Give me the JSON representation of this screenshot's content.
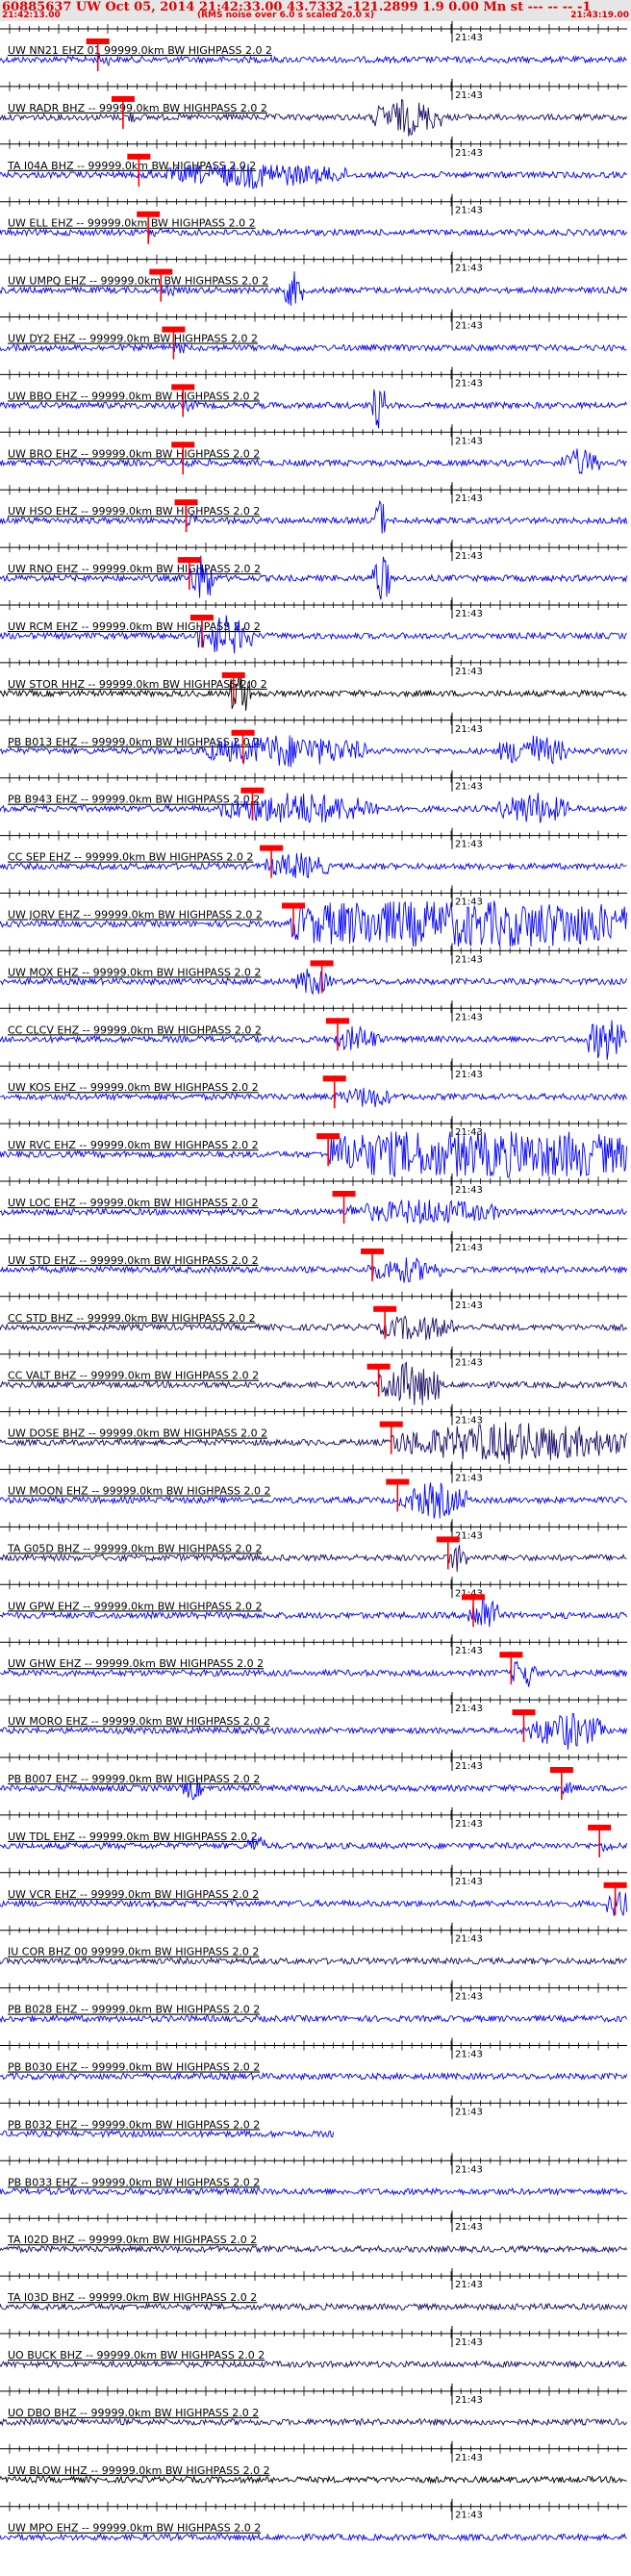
{
  "header": {
    "title": "60885637 UW Oct 05, 2014 21:42:33.00   43.7332 -121.2899  1.9 0.00 Mn st --- -- --  -1",
    "start_time": "21:42:13.00",
    "end_time": "21:43:19.00",
    "rms_note": "(RMS noise over 6.0 s scaled 20.0 x)"
  },
  "chart_data": {
    "type": "seismogram",
    "time_tick_label": "21:43",
    "colors": {
      "trace_blue": "#0000ff",
      "trace_navy": "#1a0a66",
      "trace_black": "#000000",
      "pick": "#ff0000",
      "axis": "#000000",
      "text": "#000000"
    },
    "stations": [
      {
        "label": "UW NN21 EHZ 01 99999.0km BW  HIGHPASS  2.0  2",
        "color": "blue",
        "pick": 0.155,
        "burst": null,
        "bursts2": null
      },
      {
        "label": "UW RADR BHZ -- 99999.0km BW  HIGHPASS  2.0  2",
        "color": "navy",
        "pick": 0.195,
        "burst": [
          0.59,
          0.7,
          2.0
        ],
        "bursts2": null
      },
      {
        "label": "TA I04A BHZ -- 99999.0km BW  HIGHPASS  2.0  2",
        "color": "blue",
        "pick": 0.22,
        "burst": [
          0.26,
          0.55,
          1.4
        ],
        "bursts2": null
      },
      {
        "label": "UW ELL EHZ -- 99999.0km BW  HIGHPASS  2.0  2",
        "color": "blue",
        "pick": 0.235,
        "burst": null,
        "bursts2": null
      },
      {
        "label": "UW UMPQ EHZ -- 99999.0km BW  HIGHPASS  2.0  2",
        "color": "blue",
        "pick": 0.255,
        "burst": [
          0.45,
          0.48,
          2.0
        ],
        "bursts2": null
      },
      {
        "label": "UW DY2 EHZ -- 99999.0km BW  HIGHPASS  2.0  2",
        "color": "blue",
        "pick": 0.275,
        "burst": null,
        "bursts2": null
      },
      {
        "label": "UW BBO EHZ -- 99999.0km BW  HIGHPASS  2.0  2",
        "color": "blue",
        "pick": 0.29,
        "burst": [
          0.59,
          0.61,
          3.0
        ],
        "bursts2": null
      },
      {
        "label": "UW BRO EHZ -- 99999.0km BW  HIGHPASS  2.0  2",
        "color": "blue",
        "pick": 0.29,
        "burst": [
          0.89,
          0.95,
          1.6
        ],
        "bursts2": null
      },
      {
        "label": "UW HSO EHZ -- 99999.0km BW  HIGHPASS  2.0  2",
        "color": "blue",
        "pick": 0.295,
        "burst": [
          0.59,
          0.61,
          3.0
        ],
        "bursts2": null
      },
      {
        "label": "UW RNO EHZ -- 99999.0km BW  HIGHPASS  2.0  2",
        "color": "blue",
        "pick": 0.3,
        "burst": [
          0.3,
          0.34,
          3.0
        ],
        "bursts2": [
          0.59,
          0.62,
          3.0
        ]
      },
      {
        "label": "UW RCM EHZ -- 99999.0km BW  HIGHPASS  2.0  2",
        "color": "blue",
        "pick": 0.32,
        "burst": [
          0.31,
          0.4,
          2.2
        ],
        "bursts2": null
      },
      {
        "label": "UW STOR HHZ -- 99999.0km BW  HIGHPASS  2.0  2",
        "color": "black",
        "pick": 0.37,
        "burst": [
          0.36,
          0.4,
          2.4
        ],
        "bursts2": null
      },
      {
        "label": "PB B013 EHZ -- 99999.0km BW  HIGHPASS  2.0  2",
        "color": "blue",
        "pick": 0.385,
        "burst": [
          0.32,
          0.58,
          1.8
        ],
        "bursts2": [
          0.79,
          0.9,
          1.8
        ]
      },
      {
        "label": "PB B943 EHZ -- 99999.0km BW  HIGHPASS  2.0  2",
        "color": "blue",
        "pick": 0.4,
        "burst": [
          0.35,
          0.6,
          1.8
        ],
        "bursts2": [
          0.79,
          0.9,
          1.8
        ]
      },
      {
        "label": "CC SEP EHZ -- 99999.0km BW  HIGHPASS  2.0  2",
        "color": "blue",
        "pick": 0.43,
        "burst": [
          0.42,
          0.52,
          1.5
        ],
        "bursts2": null
      },
      {
        "label": "UW JORV EHZ -- 99999.0km BW  HIGHPASS  2.0  2",
        "color": "blue",
        "pick": 0.465,
        "burst": [
          0.46,
          1.0,
          3.5
        ],
        "bursts2": null
      },
      {
        "label": "UW MOX EHZ -- 99999.0km BW  HIGHPASS  2.0  2",
        "color": "blue",
        "pick": 0.51,
        "burst": [
          0.47,
          0.52,
          1.6
        ],
        "bursts2": null
      },
      {
        "label": "CC CLCV EHZ -- 99999.0km BW  HIGHPASS  2.0  2",
        "color": "blue",
        "pick": 0.535,
        "burst": [
          0.53,
          0.6,
          1.5
        ],
        "bursts2": [
          0.93,
          0.99,
          2.5
        ]
      },
      {
        "label": "UW KOS EHZ -- 99999.0km BW  HIGHPASS  2.0  2",
        "color": "blue",
        "pick": 0.53,
        "burst": [
          0.55,
          0.62,
          1.3
        ],
        "bursts2": null
      },
      {
        "label": "UW RVC EHZ -- 99999.0km BW  HIGHPASS  2.0  2",
        "color": "blue",
        "pick": 0.52,
        "burst": [
          0.52,
          1.0,
          3.5
        ],
        "bursts2": null
      },
      {
        "label": "UW LOC EHZ -- 99999.0km BW  HIGHPASS  2.0  2",
        "color": "blue",
        "pick": 0.545,
        "burst": [
          0.55,
          0.8,
          1.4
        ],
        "bursts2": null
      },
      {
        "label": "UW STD EHZ -- 99999.0km BW  HIGHPASS  2.0  2",
        "color": "blue",
        "pick": 0.59,
        "burst": [
          0.58,
          0.7,
          1.4
        ],
        "bursts2": null
      },
      {
        "label": "CC STD BHZ -- 99999.0km BW  HIGHPASS  2.0  2",
        "color": "navy",
        "pick": 0.61,
        "burst": [
          0.6,
          0.72,
          1.5
        ],
        "bursts2": null
      },
      {
        "label": "CC VALT BHZ -- 99999.0km BW  HIGHPASS  2.0  2",
        "color": "navy",
        "pick": 0.6,
        "burst": [
          0.6,
          0.7,
          2.6
        ],
        "bursts2": null
      },
      {
        "label": "UW DOSE BHZ -- 99999.0km BW  HIGHPASS  2.0  2",
        "color": "navy",
        "pick": 0.62,
        "burst": [
          0.62,
          1.0,
          2.2
        ],
        "bursts2": null
      },
      {
        "label": "UW MOON EHZ -- 99999.0km BW  HIGHPASS  2.0  2",
        "color": "blue",
        "pick": 0.63,
        "burst": [
          0.64,
          0.74,
          2.0
        ],
        "bursts2": null
      },
      {
        "label": "TA G05D BHZ -- 99999.0km BW  HIGHPASS  2.0  2",
        "color": "navy",
        "pick": 0.71,
        "burst": [
          0.71,
          0.74,
          1.6
        ],
        "bursts2": null
      },
      {
        "label": "UW GPW EHZ -- 99999.0km BW  HIGHPASS  2.0  2",
        "color": "blue",
        "pick": 0.75,
        "burst": [
          0.74,
          0.79,
          2.4
        ],
        "bursts2": null
      },
      {
        "label": "UW GHW EHZ -- 99999.0km BW  HIGHPASS  2.0  2",
        "color": "blue",
        "pick": 0.81,
        "burst": [
          0.81,
          0.85,
          1.8
        ],
        "bursts2": null
      },
      {
        "label": "UW MORO EHZ -- 99999.0km BW  HIGHPASS  2.0  2",
        "color": "blue",
        "pick": 0.83,
        "burst": [
          0.84,
          0.96,
          2.0
        ],
        "bursts2": null
      },
      {
        "label": "PB B007 EHZ -- 99999.0km BW  HIGHPASS  2.0  2",
        "color": "blue",
        "pick": 0.89,
        "burst": [
          0.29,
          0.32,
          1.3
        ],
        "bursts2": null
      },
      {
        "label": "UW TDL EHZ -- 99999.0km BW  HIGHPASS  2.0  2",
        "color": "blue",
        "pick": 0.95,
        "burst": [
          0.39,
          0.42,
          1.3
        ],
        "bursts2": null
      },
      {
        "label": "UW VCR EHZ -- 99999.0km BW  HIGHPASS  2.0  2",
        "color": "blue",
        "pick": 0.975,
        "burst": [
          0.96,
          1.0,
          1.6
        ],
        "bursts2": null
      },
      {
        "label": "IU COR BHZ 00 99999.0km BW  HIGHPASS  2.0  2",
        "color": "navy",
        "pick": null,
        "burst": null,
        "bursts2": null
      },
      {
        "label": "PB B028 EHZ -- 99999.0km BW  HIGHPASS  2.0  2",
        "color": "blue",
        "pick": null,
        "burst": null,
        "bursts2": null
      },
      {
        "label": "PB B030 EHZ -- 99999.0km BW  HIGHPASS  2.0  2",
        "color": "blue",
        "pick": null,
        "burst": null,
        "bursts2": null
      },
      {
        "label": "PB B032 EHZ -- 99999.0km BW  HIGHPASS  2.0  2",
        "color": "blue",
        "pick": null,
        "burst": null,
        "bursts2": null,
        "truncate": 0.53
      },
      {
        "label": "PB B033 EHZ -- 99999.0km BW  HIGHPASS  2.0  2",
        "color": "blue",
        "pick": null,
        "burst": null,
        "bursts2": null
      },
      {
        "label": "TA I02D BHZ -- 99999.0km BW  HIGHPASS  2.0  2",
        "color": "navy",
        "pick": null,
        "burst": null,
        "bursts2": null
      },
      {
        "label": "TA I03D BHZ -- 99999.0km BW  HIGHPASS  2.0  2",
        "color": "navy",
        "pick": null,
        "burst": null,
        "bursts2": null
      },
      {
        "label": "UO BUCK BHZ -- 99999.0km BW  HIGHPASS  2.0  2",
        "color": "navy",
        "pick": null,
        "burst": null,
        "bursts2": null
      },
      {
        "label": "UO DBO BHZ -- 99999.0km BW  HIGHPASS  2.0  2",
        "color": "navy",
        "pick": null,
        "burst": null,
        "bursts2": null
      },
      {
        "label": "UW BLOW HHZ -- 99999.0km BW  HIGHPASS  2.0  2",
        "color": "black",
        "pick": null,
        "burst": null,
        "bursts2": null
      },
      {
        "label": "UW MPO EHZ -- 99999.0km BW  HIGHPASS  2.0  2",
        "color": "blue",
        "pick": null,
        "burst": null,
        "bursts2": null
      }
    ]
  }
}
